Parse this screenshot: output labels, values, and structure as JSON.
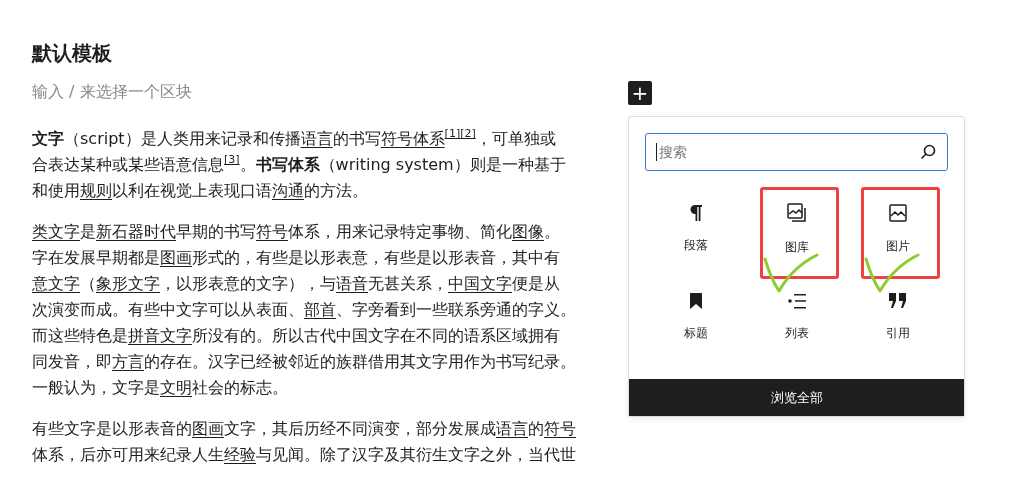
{
  "title": "默认模板",
  "block_placeholder": "输入 / 来选择一个区块",
  "add_button": "+",
  "paragraphs": [
    [
      [
        {
          "kind": "bold",
          "text": "文字"
        },
        {
          "kind": "plain",
          "text": "（script）是人类用来记录和传播"
        },
        {
          "kind": "link",
          "text": "语言"
        },
        {
          "kind": "plain",
          "text": "的书写"
        },
        {
          "kind": "link",
          "text": "符号体系"
        },
        {
          "kind": "sup",
          "text": "[1]"
        },
        {
          "kind": "sup",
          "text": "[2]"
        },
        {
          "kind": "plain",
          "text": "，可单独或"
        }
      ],
      [
        {
          "kind": "plain",
          "text": "合表达某种或某些语意信息"
        },
        {
          "kind": "sup",
          "text": "[3]"
        },
        {
          "kind": "plain",
          "text": "。"
        },
        {
          "kind": "bold",
          "text": "书写体系"
        },
        {
          "kind": "plain",
          "text": "（writing system）则是一种基于"
        }
      ],
      [
        {
          "kind": "plain",
          "text": "和使用"
        },
        {
          "kind": "link",
          "text": "规则"
        },
        {
          "kind": "plain",
          "text": "以利在视觉上表现口语"
        },
        {
          "kind": "link",
          "text": "沟通"
        },
        {
          "kind": "plain",
          "text": "的方法。"
        }
      ]
    ],
    [
      [
        {
          "kind": "link",
          "text": "类文字"
        },
        {
          "kind": "plain",
          "text": "是"
        },
        {
          "kind": "link",
          "text": "新石器时代"
        },
        {
          "kind": "plain",
          "text": "早期的书写"
        },
        {
          "kind": "link",
          "text": "符号"
        },
        {
          "kind": "plain",
          "text": "体系，用来记录特定事物、简化"
        },
        {
          "kind": "link",
          "text": "图像"
        },
        {
          "kind": "plain",
          "text": "。"
        }
      ],
      [
        {
          "kind": "plain",
          "text": "字在发展早期都是"
        },
        {
          "kind": "link",
          "text": "图画"
        },
        {
          "kind": "plain",
          "text": "形式的，有些是以形表意，有些是以形表音，其中有"
        }
      ],
      [
        {
          "kind": "link",
          "text": "意文字"
        },
        {
          "kind": "plain",
          "text": "（"
        },
        {
          "kind": "link",
          "text": "象形文字"
        },
        {
          "kind": "plain",
          "text": "，以形表意的文字），与"
        },
        {
          "kind": "link",
          "text": "语音"
        },
        {
          "kind": "plain",
          "text": "无甚关系，"
        },
        {
          "kind": "link",
          "text": "中国文字"
        },
        {
          "kind": "plain",
          "text": "便是从"
        }
      ],
      [
        {
          "kind": "plain",
          "text": "次演变而成。有些中文字可以从表面、"
        },
        {
          "kind": "link",
          "text": "部首"
        },
        {
          "kind": "plain",
          "text": "、字旁看到一些联系旁通的字义。"
        }
      ],
      [
        {
          "kind": "plain",
          "text": "而这些特色是"
        },
        {
          "kind": "link",
          "text": "拼音文字"
        },
        {
          "kind": "plain",
          "text": "所没有的。所以古代中国文字在不同的语系区域拥有"
        }
      ],
      [
        {
          "kind": "plain",
          "text": "同发音，即"
        },
        {
          "kind": "link",
          "text": "方言"
        },
        {
          "kind": "plain",
          "text": "的存在。汉字已经被邻近的族群借用其文字用作为书写纪录。"
        }
      ],
      [
        {
          "kind": "plain",
          "text": "一般认为，文字是"
        },
        {
          "kind": "link",
          "text": "文明"
        },
        {
          "kind": "plain",
          "text": "社会的标志。"
        }
      ]
    ],
    [
      [
        {
          "kind": "plain",
          "text": "有些文字是以形表音的"
        },
        {
          "kind": "link",
          "text": "图画"
        },
        {
          "kind": "plain",
          "text": "文字，其后历经不同演变，部分发展成"
        },
        {
          "kind": "link",
          "text": "语言"
        },
        {
          "kind": "plain",
          "text": "的"
        },
        {
          "kind": "link",
          "text": "符号"
        }
      ],
      [
        {
          "kind": "plain",
          "text": "体系，后亦可用来纪录人生"
        },
        {
          "kind": "link",
          "text": "经验"
        },
        {
          "kind": "plain",
          "text": "与见闻。除了汉字及其衍生文字之外，当代世"
        }
      ]
    ]
  ],
  "inserter": {
    "search": {
      "placeholder": "搜索"
    },
    "blocks": [
      {
        "kind": "paragraph",
        "label": "段落",
        "annotated": false
      },
      {
        "kind": "gallery",
        "label": "图库",
        "annotated": true
      },
      {
        "kind": "image",
        "label": "图片",
        "annotated": true
      },
      {
        "kind": "heading",
        "label": "标题",
        "annotated": false
      },
      {
        "kind": "list",
        "label": "列表",
        "annotated": false
      },
      {
        "kind": "quote",
        "label": "引用",
        "annotated": false
      }
    ],
    "browse_all": "浏览全部"
  }
}
